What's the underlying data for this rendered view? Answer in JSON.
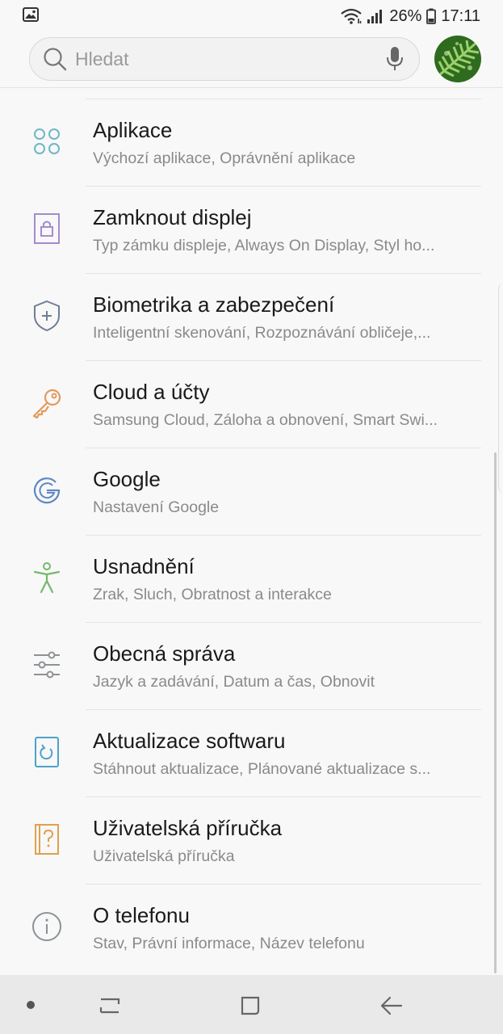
{
  "status_bar": {
    "battery": "26%",
    "time": "17:11",
    "icons": [
      "gallery-notification-icon",
      "wifi-icon",
      "signal-icon",
      "battery-icon"
    ]
  },
  "search": {
    "placeholder": "Hledat",
    "icon": "search-icon",
    "voice_icon": "microphone-icon"
  },
  "profile": {
    "icon": "avatar"
  },
  "settings": {
    "items": [
      {
        "title": "Aplikace",
        "subtitle": "Výchozí aplikace, Oprávnění aplikace",
        "icon": "apps-grid-icon",
        "color": "#6fb7c6"
      },
      {
        "title": "Zamknout displej",
        "subtitle": "Typ zámku displeje, Always On Display, Styl ho...",
        "icon": "lock-screen-icon",
        "color": "#a48bd0"
      },
      {
        "title": "Biometrika a zabezpečení",
        "subtitle": "Inteligentní skenování, Rozpoznávání obličeje,...",
        "icon": "shield-icon",
        "color": "#6f7f94"
      },
      {
        "title": "Cloud a účty",
        "subtitle": "Samsung Cloud, Záloha a obnovení, Smart Swi...",
        "icon": "key-icon",
        "color": "#e29a5c"
      },
      {
        "title": "Google",
        "subtitle": "Nastavení Google",
        "icon": "google-icon",
        "color": "#5f88c4"
      },
      {
        "title": "Usnadnění",
        "subtitle": "Zrak, Sluch, Obratnost a interakce",
        "icon": "accessibility-icon",
        "color": "#73b96c"
      },
      {
        "title": "Obecná správa",
        "subtitle": "Jazyk a zadávání, Datum a čas, Obnovit",
        "icon": "sliders-icon",
        "color": "#8c9296"
      },
      {
        "title": "Aktualizace softwaru",
        "subtitle": "Stáhnout aktualizace, Plánované aktualizace s...",
        "icon": "software-update-icon",
        "color": "#4da3c9"
      },
      {
        "title": "Uživatelská příručka",
        "subtitle": "Uživatelská příručka",
        "icon": "user-manual-icon",
        "color": "#e0a04f"
      },
      {
        "title": "O telefonu",
        "subtitle": "Stav, Právní informace, Název telefonu",
        "icon": "info-icon",
        "color": "#8c9296"
      }
    ]
  },
  "nav_bar": {
    "icons": [
      "nav-dot-icon",
      "recent-apps-icon",
      "home-icon",
      "back-icon"
    ]
  }
}
